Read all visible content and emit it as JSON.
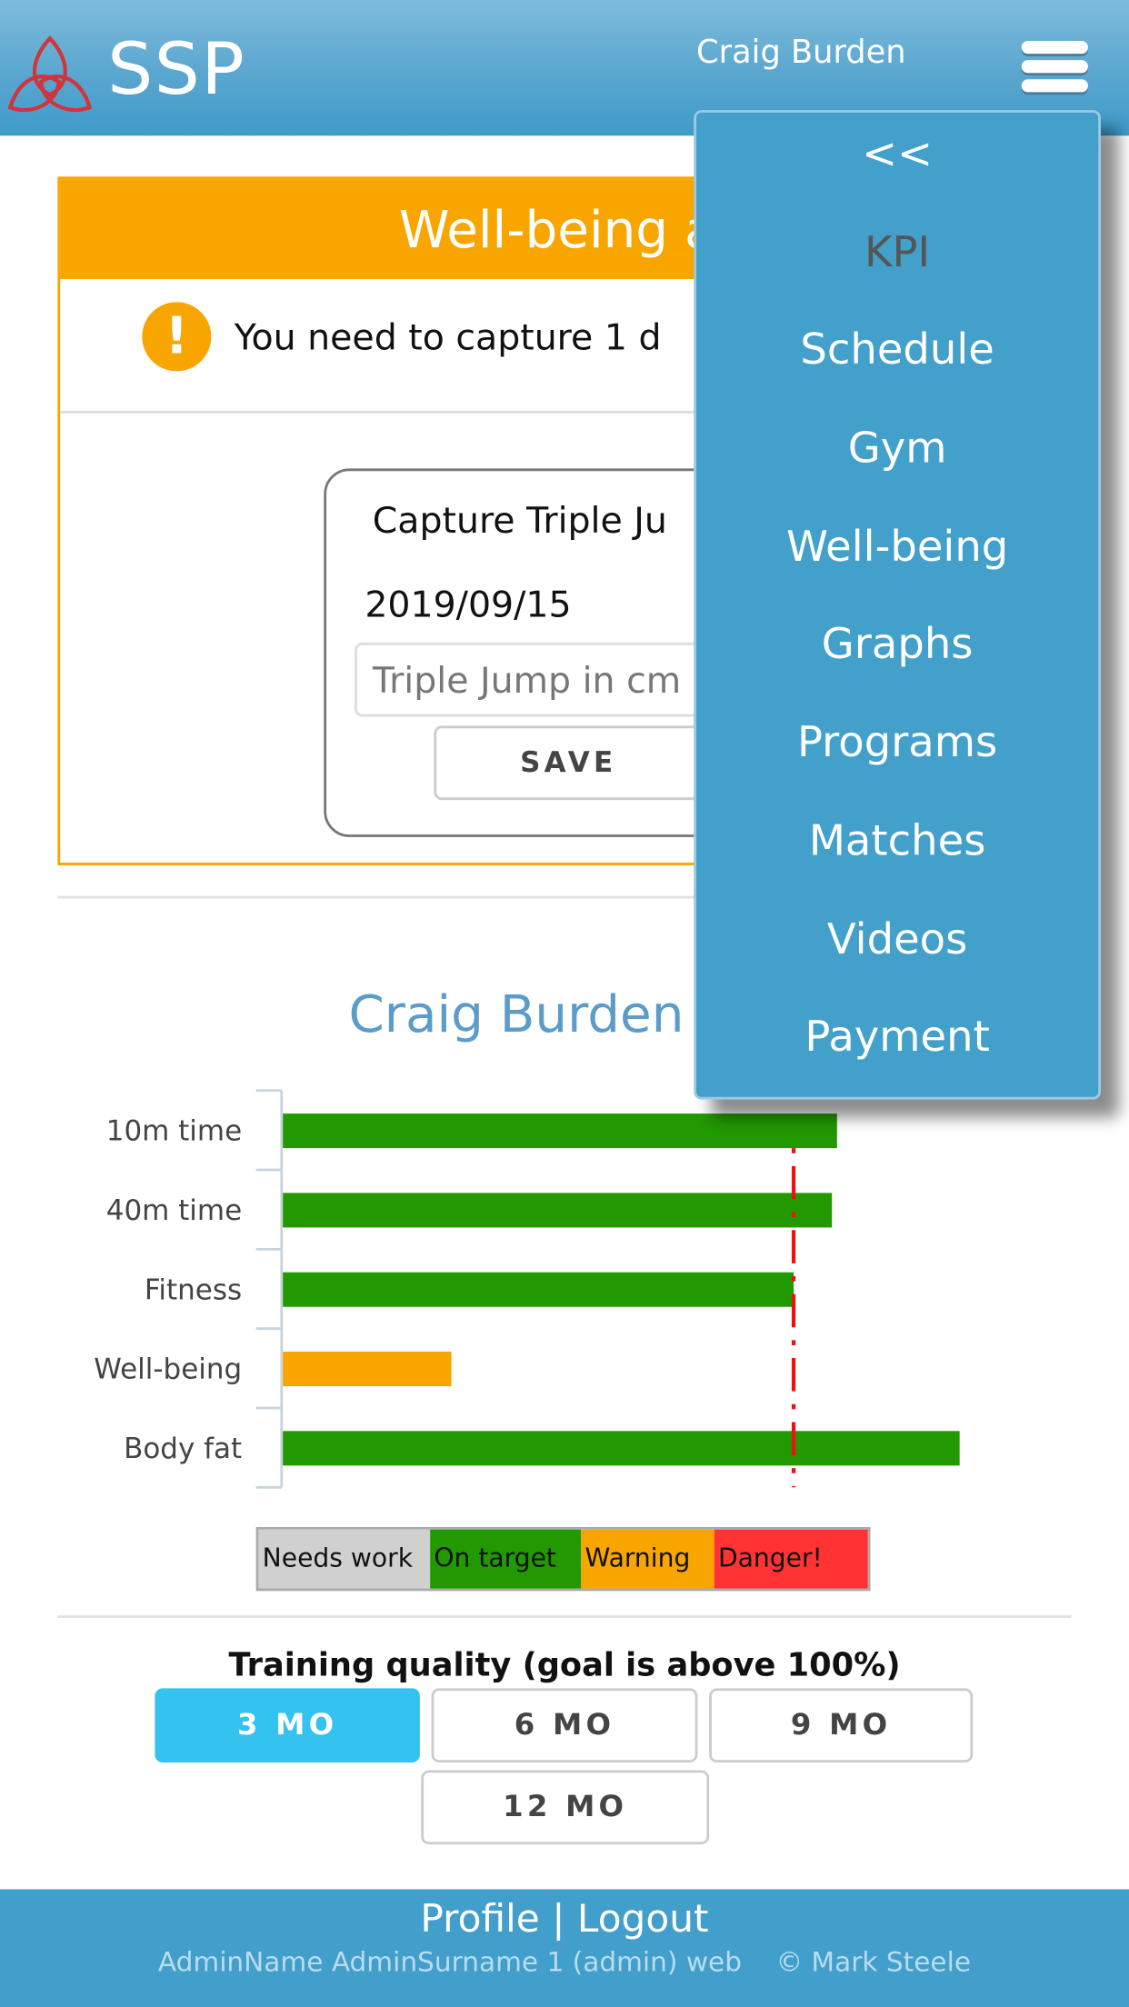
{
  "header": {
    "brand": "SSP",
    "username": "Craig Burden",
    "menu_icon": "hamburger-icon"
  },
  "menu": {
    "items": [
      {
        "label": "<<",
        "current": false
      },
      {
        "label": "KPI",
        "current": true
      },
      {
        "label": "Schedule",
        "current": false
      },
      {
        "label": "Gym",
        "current": false
      },
      {
        "label": "Well-being",
        "current": false
      },
      {
        "label": "Graphs",
        "current": false
      },
      {
        "label": "Programs",
        "current": false
      },
      {
        "label": "Matches",
        "current": false
      },
      {
        "label": "Videos",
        "current": false
      },
      {
        "label": "Payment",
        "current": false
      }
    ]
  },
  "alert": {
    "title": "Well-being al",
    "message": "You need to capture 1 d",
    "icon": "exclamation-icon",
    "color": "#f9a500"
  },
  "capture": {
    "title": "Capture Triple Ju",
    "date": "2019/09/15",
    "input_value": "",
    "input_placeholder": "Triple Jump in cm",
    "save_label": "SAVE"
  },
  "summary": {
    "title": "Craig Burden sur"
  },
  "chart_data": {
    "type": "bar",
    "orientation": "horizontal",
    "categories": [
      "10m time",
      "40m time",
      "Fitness",
      "Well-being",
      "Body fat"
    ],
    "values": [
      108.5,
      107.5,
      100,
      33,
      132.5
    ],
    "unit": "percent of target (estimated)",
    "bar_colors": [
      "#229900",
      "#229900",
      "#229900",
      "#f9a500",
      "#229900"
    ],
    "target_line": 100,
    "target_line_color": "#ee1111",
    "grid": false,
    "legend": [
      {
        "label": "Needs work",
        "color": "#d0d0d0"
      },
      {
        "label": "On target",
        "color": "#229900"
      },
      {
        "label": "Warning",
        "color": "#f9a500"
      },
      {
        "label": "Danger!",
        "color": "#ff3333"
      }
    ],
    "legend_placement": "bottom"
  },
  "training": {
    "title": "Training quality (goal is above 100%)",
    "periods": [
      "3 MO",
      "6 MO",
      "9 MO",
      "12 MO"
    ],
    "selected": "3 MO"
  },
  "footer": {
    "profile": "Profile",
    "separator": "|",
    "logout": "Logout",
    "info": "AdminName AdminSurname 1 (admin) web",
    "copyright": "© Mark Steele"
  }
}
